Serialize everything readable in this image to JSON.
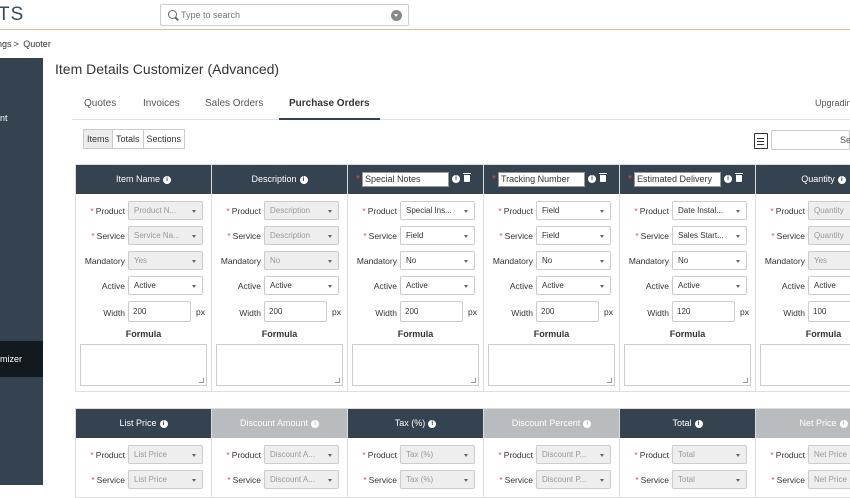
{
  "app": {
    "logo": "TS"
  },
  "search": {
    "placeholder": "Type to search"
  },
  "breadcrumb": {
    "parent": "ngs",
    "separator": ">",
    "current": "Quoter"
  },
  "sidebar": {
    "item_a": "nt",
    "active_item": "mizer"
  },
  "page_title": "Item Details Customizer (Advanced)",
  "tabs": [
    "Quotes",
    "Invoices",
    "Sales Orders",
    "Purchase Orders"
  ],
  "active_tab": "Purchase Orders",
  "upgrade_label": "Upgradin",
  "subtabs": [
    "Items",
    "Totals",
    "Sections"
  ],
  "right_search": {
    "label": "Se"
  },
  "labels": {
    "product": "Product",
    "service": "Service",
    "mandatory": "Mandatory",
    "active": "Active",
    "width": "Width",
    "px": "px",
    "formula": "Formula"
  },
  "columns": [
    {
      "title": "Item Name",
      "editable": false,
      "product": "Product N...",
      "service": "Service Na...",
      "mandatory": "Yes",
      "active": "Active",
      "width": "200",
      "disabled": [
        true,
        true,
        true,
        false
      ]
    },
    {
      "title": "Description",
      "editable": false,
      "product": "Description",
      "service": "Description",
      "mandatory": "No",
      "active": "Active",
      "width": "200",
      "disabled": [
        true,
        true,
        true,
        false
      ]
    },
    {
      "title": "Special Notes",
      "editable": true,
      "product": "Special Ins...",
      "service": "Field",
      "mandatory": "No",
      "active": "Active",
      "width": "200",
      "disabled": [
        false,
        false,
        false,
        false
      ]
    },
    {
      "title": "Tracking Number",
      "editable": true,
      "product": "Field",
      "service": "Field",
      "mandatory": "No",
      "active": "Active",
      "width": "200",
      "disabled": [
        false,
        false,
        false,
        false
      ]
    },
    {
      "title": "Estimated Delivery",
      "editable": true,
      "product": "Date Instal...",
      "service": "Sales Start...",
      "mandatory": "No",
      "active": "Active",
      "width": "120",
      "disabled": [
        false,
        false,
        false,
        false
      ]
    },
    {
      "title": "Quantity",
      "editable": false,
      "product": "Quantity",
      "service": "Quantity",
      "mandatory": "Yes",
      "active": "Active",
      "width": "100",
      "disabled": [
        true,
        true,
        true,
        false
      ]
    }
  ],
  "columns2": [
    {
      "title": "List Price",
      "grey": false,
      "product": "List Price",
      "service": "List Price"
    },
    {
      "title": "Discount Amount",
      "grey": true,
      "product": "Discount A...",
      "service": "Discount A..."
    },
    {
      "title": "Tax (%)",
      "grey": false,
      "product": "Tax (%)",
      "service": "Tax (%)"
    },
    {
      "title": "Discount Percent",
      "grey": true,
      "product": "Discount P...",
      "service": "Discount P..."
    },
    {
      "title": "Total",
      "grey": false,
      "product": "Total",
      "service": "Total"
    },
    {
      "title": "Net Price",
      "grey": true,
      "product": "Net Price",
      "service": "Net Price"
    }
  ]
}
